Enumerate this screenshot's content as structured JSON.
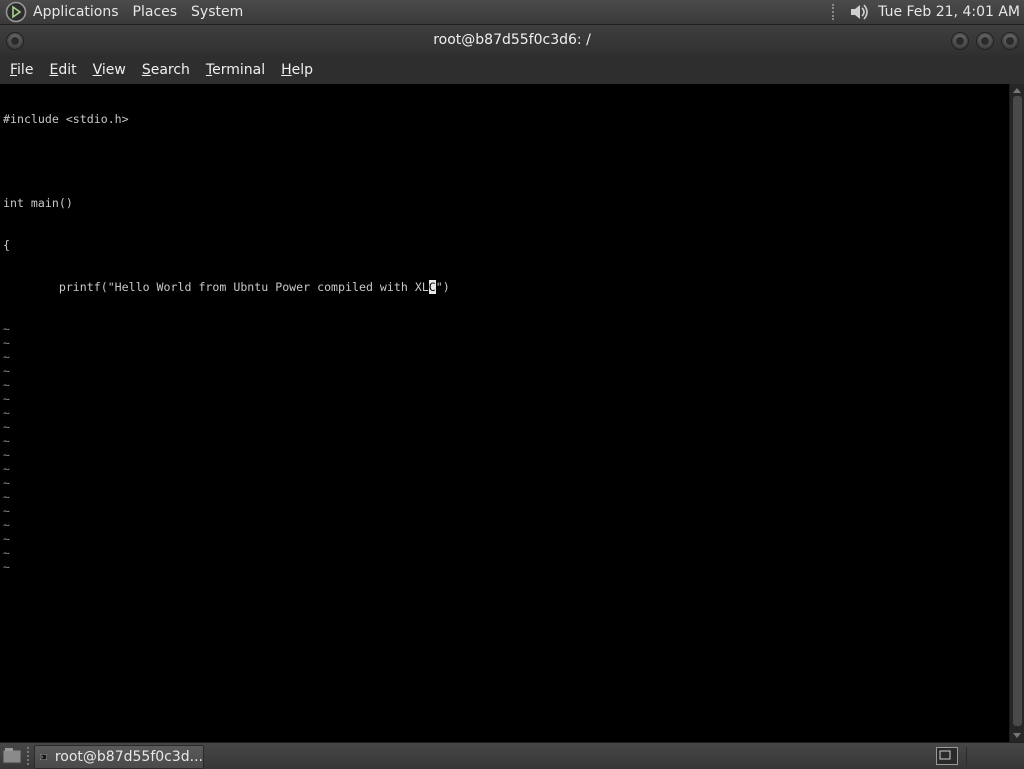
{
  "top_panel": {
    "menus": [
      "Applications",
      "Places",
      "System"
    ],
    "clock": "Tue Feb 21,  4:01 AM"
  },
  "window": {
    "title": "root@b87d55f0c3d6: /",
    "menubar": [
      {
        "mnemonic": "F",
        "rest": "ile"
      },
      {
        "mnemonic": "E",
        "rest": "dit"
      },
      {
        "mnemonic": "V",
        "rest": "iew"
      },
      {
        "mnemonic": "S",
        "rest": "earch"
      },
      {
        "mnemonic": "T",
        "rest": "erminal"
      },
      {
        "mnemonic": "H",
        "rest": "elp"
      }
    ]
  },
  "terminal": {
    "lines": [
      "#include <stdio.h>",
      "",
      "int main()",
      "{",
      "        printf(\"Hello World from Ubntu Power compiled with XL"
    ],
    "cursor_char": "C",
    "after_cursor": "\")",
    "tilde_count": 18
  },
  "taskbar": {
    "item_label": "root@b87d55f0c3d..."
  },
  "colors": {
    "terminal_bg": "#000000",
    "terminal_fg": "#c8c8c8",
    "panel_bg": "#3a3a3a"
  }
}
